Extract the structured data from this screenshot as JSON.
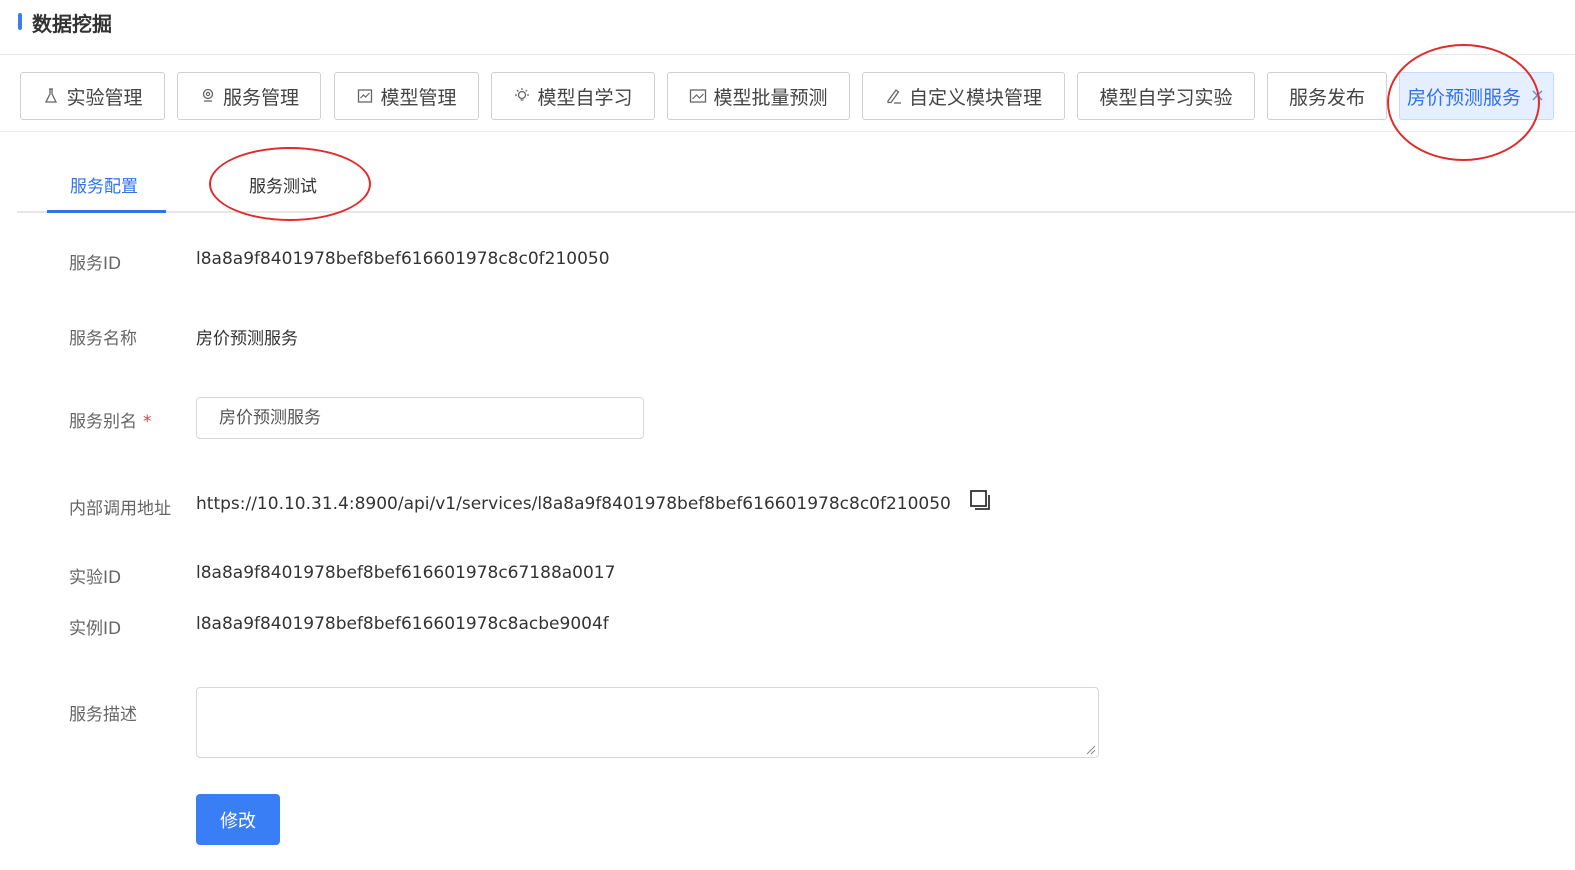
{
  "header": {
    "title": "数据挖掘"
  },
  "top_tabs": [
    {
      "label": "实验管理",
      "icon": "flask-icon"
    },
    {
      "label": "服务管理",
      "icon": "location-icon"
    },
    {
      "label": "模型管理",
      "icon": "chart-box-icon"
    },
    {
      "label": "模型自学习",
      "icon": "bulb-icon"
    },
    {
      "label": "模型批量预测",
      "icon": "line-chart-icon"
    },
    {
      "label": "自定义模块管理",
      "icon": "edit-icon"
    },
    {
      "label": "模型自学习实验",
      "icon": ""
    },
    {
      "label": "服务发布",
      "icon": ""
    },
    {
      "label": "房价预测服务",
      "icon": "",
      "active": true,
      "closable": true
    }
  ],
  "close_glyph": "×",
  "sub_tabs": [
    {
      "label": "服务配置",
      "active": true
    },
    {
      "label": "服务测试",
      "active": false
    }
  ],
  "form": {
    "service_id": {
      "label": "服务ID",
      "value": "l8a8a9f8401978bef8bef616601978c8c0f210050"
    },
    "service_name": {
      "label": "服务名称",
      "value": "房价预测服务"
    },
    "service_alias": {
      "label": "服务别名",
      "required_mark": "*",
      "value": "房价预测服务"
    },
    "internal_url": {
      "label": "内部调用地址",
      "value": "https://10.10.31.4:8900/api/v1/services/l8a8a9f8401978bef8bef616601978c8c0f210050"
    },
    "experiment_id": {
      "label": "实验ID",
      "value": "l8a8a9f8401978bef8bef616601978c67188a0017"
    },
    "instance_id": {
      "label": "实例ID",
      "value": "l8a8a9f8401978bef8bef616601978c8acbe9004f"
    },
    "description": {
      "label": "服务描述",
      "value": ""
    }
  },
  "submit_button": {
    "label": "修改"
  },
  "colors": {
    "accent": "#2f72ea",
    "button": "#3a7ef5",
    "highlight": "#e02b2b"
  }
}
